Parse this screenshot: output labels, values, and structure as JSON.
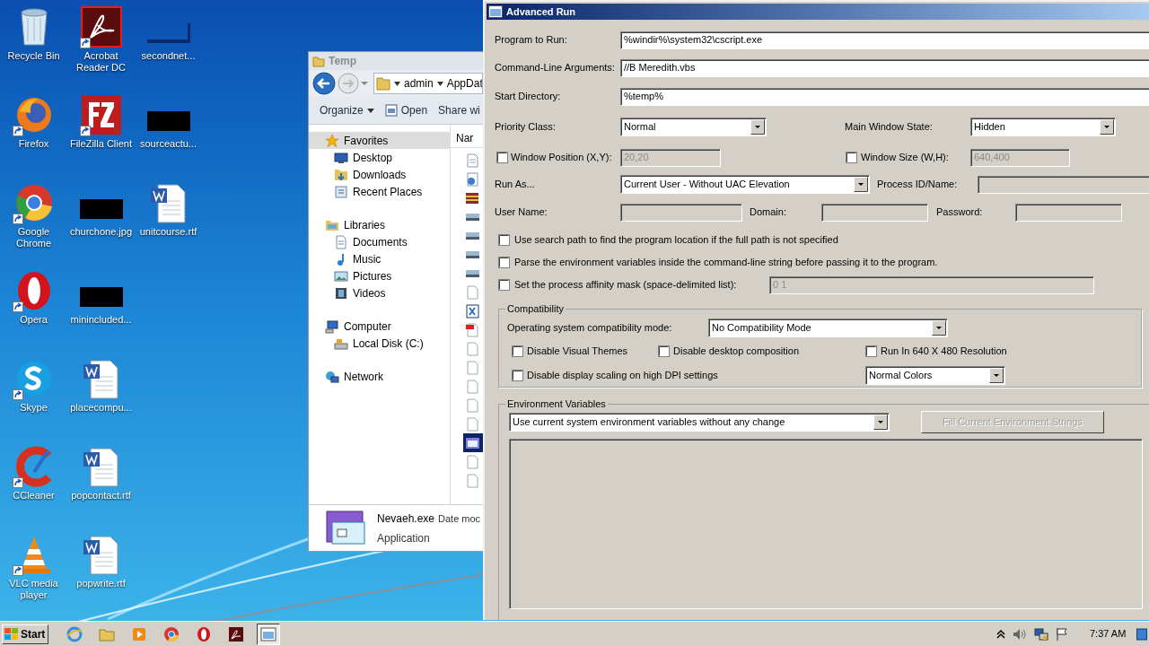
{
  "desktop": {
    "icons": [
      {
        "label": "Recycle Bin",
        "kind": "recycle",
        "shortcut": false
      },
      {
        "label": "Firefox",
        "kind": "firefox",
        "shortcut": true
      },
      {
        "label": "Google Chrome",
        "kind": "chrome",
        "shortcut": true
      },
      {
        "label": "Opera",
        "kind": "opera",
        "shortcut": true
      },
      {
        "label": "Skype",
        "kind": "skype",
        "shortcut": true
      },
      {
        "label": "CCleaner",
        "kind": "ccleaner",
        "shortcut": true
      },
      {
        "label": "VLC media player",
        "kind": "vlc",
        "shortcut": true
      },
      {
        "label": "Acrobat Reader DC",
        "kind": "acrobat",
        "shortcut": true
      },
      {
        "label": "FileZilla Client",
        "kind": "filezilla",
        "shortcut": true
      },
      {
        "label": "churchone.jpg",
        "kind": "redacted",
        "shortcut": false
      },
      {
        "label": "minincluded...",
        "kind": "redacted",
        "shortcut": false
      },
      {
        "label": "placecompu...",
        "kind": "word",
        "shortcut": false
      },
      {
        "label": "popcontact.rtf",
        "kind": "word",
        "shortcut": false
      },
      {
        "label": "popwrite.rtf",
        "kind": "word",
        "shortcut": false
      },
      {
        "label": "secondnet...",
        "kind": "redacted_line",
        "shortcut": false
      },
      {
        "label": "sourceactu...",
        "kind": "redacted",
        "shortcut": false
      },
      {
        "label": "unitcourse.rtf",
        "kind": "word",
        "shortcut": false
      }
    ]
  },
  "explorer": {
    "title": "Temp",
    "breadcrumb": [
      "admin",
      "AppDat"
    ],
    "toolbar": [
      "Organize",
      "Open",
      "Share wi"
    ],
    "nav": [
      {
        "label": "Favorites",
        "selected": true,
        "children": [
          {
            "label": "Desktop",
            "selected": false
          },
          {
            "label": "Downloads",
            "selected": false
          },
          {
            "label": "Recent Places",
            "selected": false
          }
        ]
      },
      {
        "label": "Libraries",
        "selected": false,
        "children": [
          {
            "label": "Documents",
            "selected": false
          },
          {
            "label": "Music",
            "selected": false
          },
          {
            "label": "Pictures",
            "selected": false
          },
          {
            "label": "Videos",
            "selected": false
          }
        ]
      },
      {
        "label": "Computer",
        "selected": false,
        "children": [
          {
            "label": "Local Disk (C:)",
            "selected": false
          }
        ]
      },
      {
        "label": "Network",
        "selected": false
      }
    ],
    "column_header": "Nar",
    "files": [
      {
        "kind": "doc",
        "selected": false
      },
      {
        "kind": "gear",
        "selected": false
      },
      {
        "kind": "archive",
        "selected": false
      },
      {
        "kind": "image",
        "selected": false
      },
      {
        "kind": "image",
        "selected": false
      },
      {
        "kind": "image",
        "selected": false
      },
      {
        "kind": "image",
        "selected": false
      },
      {
        "kind": "blank",
        "selected": false
      },
      {
        "kind": "script",
        "selected": false
      },
      {
        "kind": "pdf",
        "selected": false
      },
      {
        "kind": "blank",
        "selected": false
      },
      {
        "kind": "blank",
        "selected": false
      },
      {
        "kind": "blank",
        "selected": false
      },
      {
        "kind": "blank",
        "selected": false
      },
      {
        "kind": "blank",
        "selected": false
      },
      {
        "kind": "app",
        "selected": true
      },
      {
        "kind": "blank",
        "selected": false
      },
      {
        "kind": "blank",
        "selected": false
      }
    ],
    "details": {
      "name": "Nevaeh.exe",
      "meta": "Date moc",
      "type": "Application"
    }
  },
  "advanced_run": {
    "title": "Advanced Run",
    "program_to_run": {
      "label": "Program to Run:",
      "value": "%windir%\\system32\\cscript.exe"
    },
    "arguments": {
      "label": "Command-Line Arguments:",
      "value": "//B Meredith.vbs"
    },
    "start_directory": {
      "label": "Start Directory:",
      "value": "%temp%"
    },
    "priority_class": {
      "label": "Priority Class:",
      "value": "Normal"
    },
    "main_window_state": {
      "label": "Main Window State:",
      "value": "Hidden"
    },
    "window_position": {
      "label": "Window Position (X,Y):",
      "checked": false,
      "value": "20,20",
      "disabled": true
    },
    "window_size": {
      "label": "Window Size (W,H):",
      "checked": false,
      "value": "640,400",
      "disabled": true
    },
    "run_as": {
      "label": "Run As...",
      "value": "Current User - Without UAC Elevation"
    },
    "process_id": {
      "label": "Process ID/Name:"
    },
    "user_name": {
      "label": "User Name:"
    },
    "domain": {
      "label": "Domain:"
    },
    "password": {
      "label": "Password:"
    },
    "options": [
      {
        "label": "Use search path to find the program location if the full path is not specified",
        "checked": false
      },
      {
        "label": "Parse the environment variables inside the command-line string before passing it to the program.",
        "checked": false
      }
    ],
    "affinity": {
      "label": "Set the process affinity mask (space-delimited list):",
      "checked": false,
      "value": "0 1",
      "disabled": true
    },
    "compatibility": {
      "title": "Compatibility",
      "mode_label": "Operating system compatibility mode:",
      "mode_value": "No Compatibility Mode",
      "options": [
        {
          "label": "Disable Visual Themes",
          "checked": false
        },
        {
          "label": "Disable desktop composition",
          "checked": false
        },
        {
          "label": "Run In 640 X 480 Resolution",
          "checked": false
        },
        {
          "label": "Disable display scaling on high DPI settings",
          "checked": false
        }
      ],
      "colors": "Normal Colors"
    },
    "environment": {
      "title": "Environment Variables",
      "mode": "Use current system environment variables without any change",
      "fill_button": {
        "label": "Fill Current Environment Strings",
        "disabled": true
      }
    }
  },
  "taskbar": {
    "start": "Start",
    "items": [
      {
        "kind": "ie",
        "selected": false
      },
      {
        "kind": "folder",
        "selected": false
      },
      {
        "kind": "media",
        "selected": false
      },
      {
        "kind": "chrome",
        "selected": false
      },
      {
        "kind": "opera",
        "selected": false
      },
      {
        "kind": "acrobat",
        "selected": false
      },
      {
        "kind": "advrun",
        "selected": true
      }
    ],
    "clock": "7:37 AM"
  }
}
